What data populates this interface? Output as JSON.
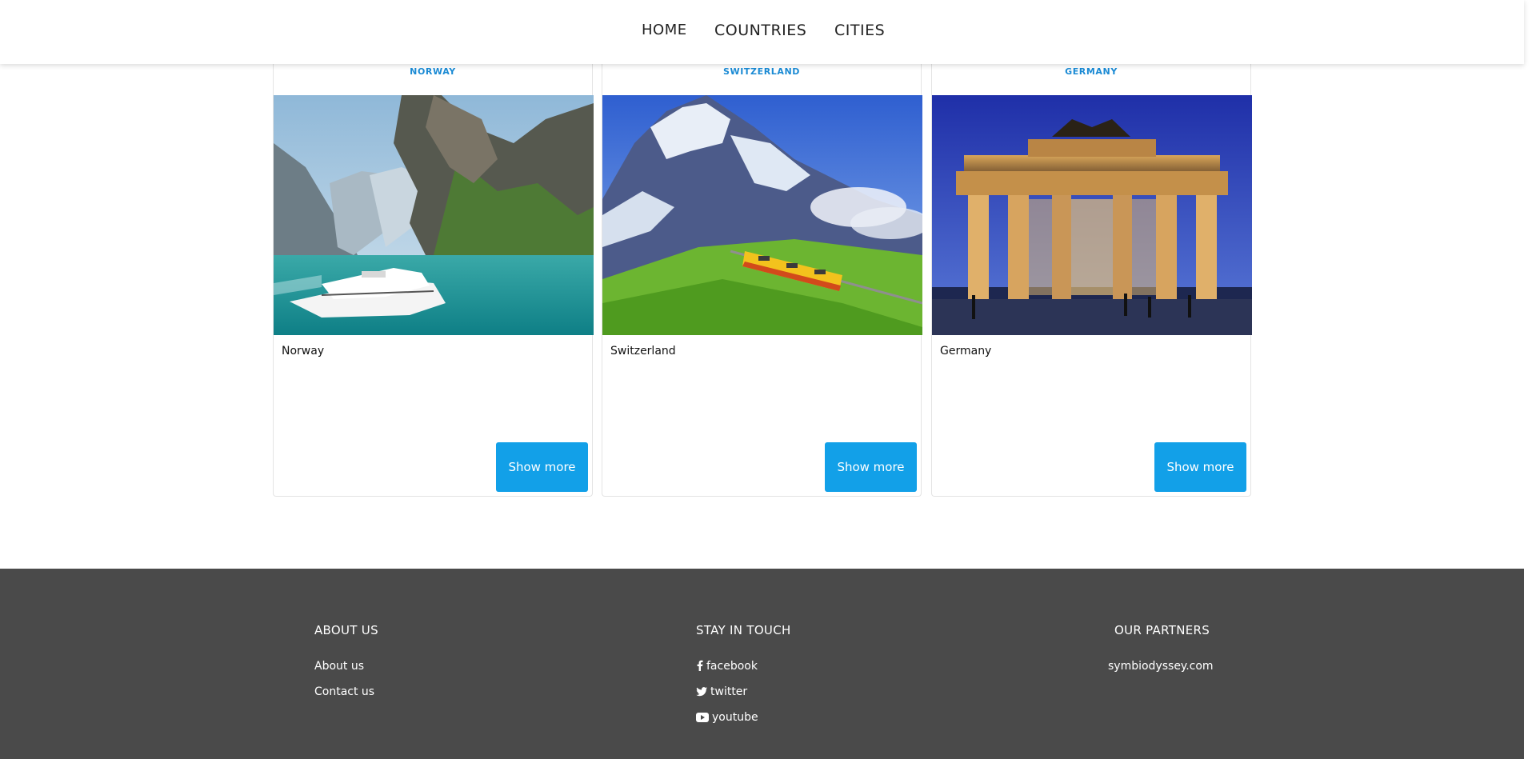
{
  "nav": {
    "items": [
      {
        "label": "HOME"
      },
      {
        "label": "COUNTRIES"
      },
      {
        "label": "CITIES"
      }
    ]
  },
  "cards": [
    {
      "header": "NORWAY",
      "title": "Norway",
      "button": "Show more",
      "image": "norway-fjord-cruise-ship"
    },
    {
      "header": "SWITZERLAND",
      "title": "Switzerland",
      "button": "Show more",
      "image": "switzerland-alps-train"
    },
    {
      "header": "GERMANY",
      "title": "Germany",
      "button": "Show more",
      "image": "brandenburg-gate-night"
    }
  ],
  "footer": {
    "about": {
      "heading": "ABOUT US",
      "links": [
        "About us",
        "Contact us"
      ]
    },
    "social": {
      "heading": "STAY IN TOUCH",
      "links": [
        {
          "icon": "facebook-icon",
          "label": "facebook"
        },
        {
          "icon": "twitter-icon",
          "label": "twitter"
        },
        {
          "icon": "youtube-icon",
          "label": "youtube"
        }
      ]
    },
    "partners": {
      "heading": "OUR PARTNERS",
      "links": [
        "symbiodyssey.com"
      ]
    }
  },
  "colors": {
    "accent": "#12a0e8",
    "header_text": "#1a8ad4",
    "footer_bg": "#4a4a4a"
  }
}
